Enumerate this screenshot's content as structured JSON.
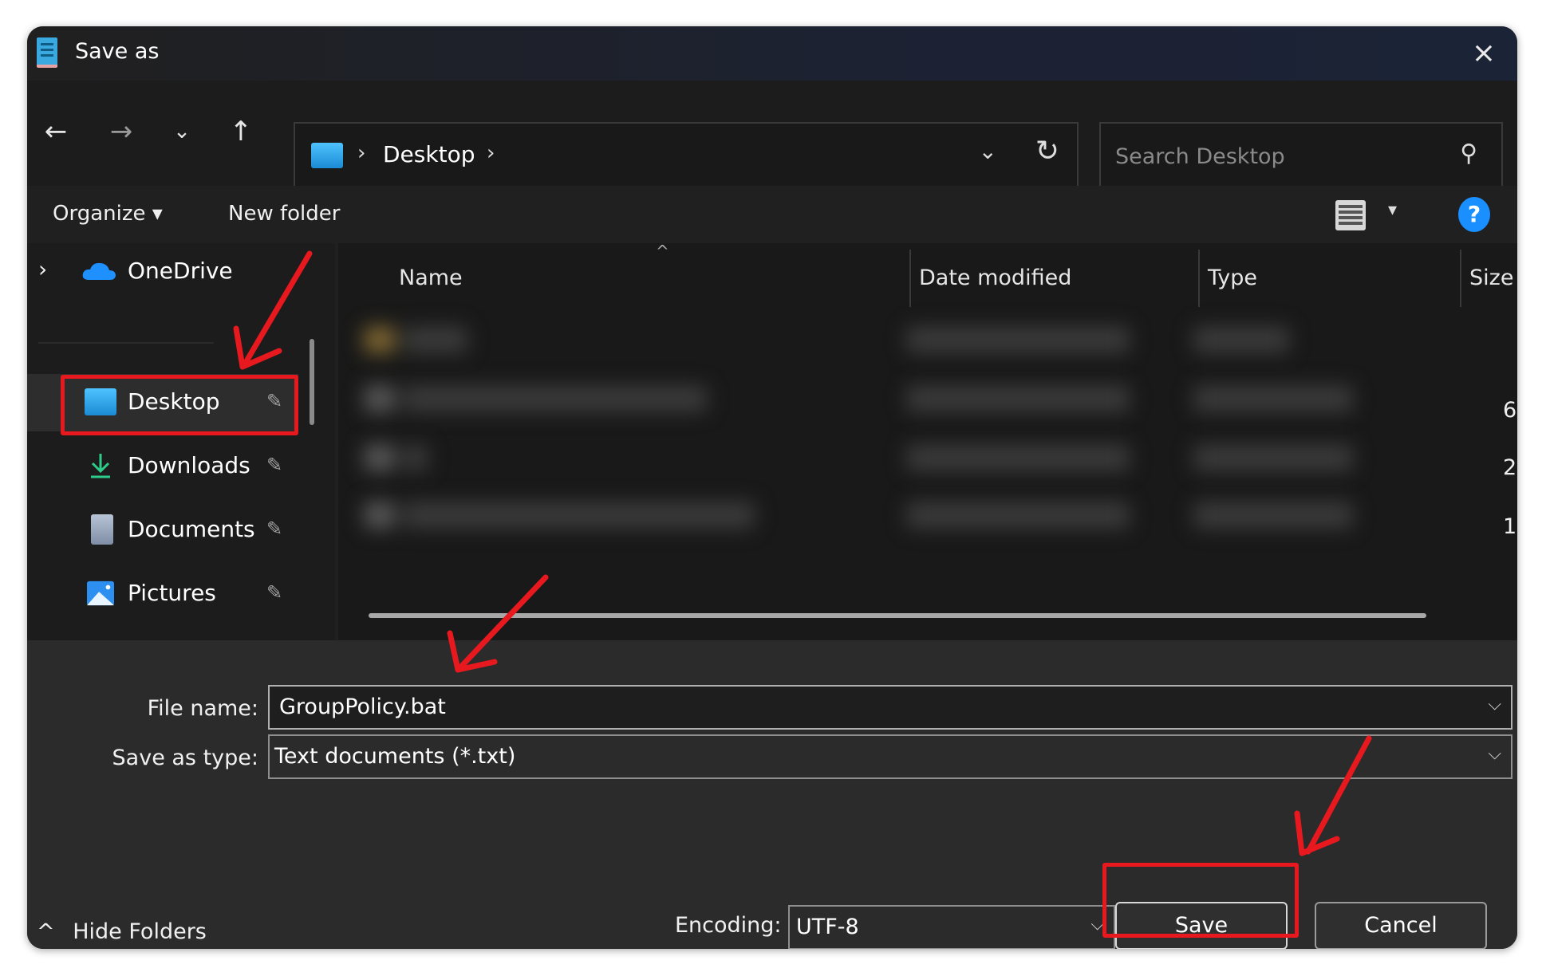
{
  "window": {
    "title": "Save as",
    "close_label": "×"
  },
  "nav": {
    "back_icon": "←",
    "forward_icon": "→",
    "recent_icon": "⌄",
    "up_icon": "↑",
    "address": {
      "separator": "›",
      "crumb": "Desktop",
      "trailing_separator": "›",
      "dropdown_icon": "⌄",
      "refresh_icon": "↻"
    },
    "search": {
      "placeholder": "Search Desktop",
      "value": "",
      "icon": "⚲"
    }
  },
  "commandbar": {
    "organize_label": "Organize ▾",
    "new_folder_label": "New folder",
    "view_dropdown_icon": "▾",
    "help_label": "?"
  },
  "sidebar": {
    "onedrive": {
      "expander": "›",
      "label": "OneDrive"
    },
    "items": [
      {
        "label": "Desktop",
        "pin": "📌",
        "selected": true
      },
      {
        "label": "Downloads",
        "pin": "📌"
      },
      {
        "label": "Documents",
        "pin": "📌"
      },
      {
        "label": "Pictures",
        "pin": "📌"
      }
    ]
  },
  "filelist": {
    "sort_indicator": "^",
    "columns": [
      "Name",
      "Date modified",
      "Type",
      "Size"
    ],
    "visible_size_digits": [
      "6",
      "2",
      "1"
    ]
  },
  "form": {
    "file_name_label": "File name:",
    "file_name_value": "GroupPolicy.bat",
    "save_type_label": "Save as type:",
    "save_type_value": "Text documents (*.txt)",
    "dropdown_icon": "⌵",
    "encoding_label": "Encoding:",
    "encoding_value": "UTF-8",
    "save_label": "Save",
    "cancel_label": "Cancel",
    "hide_folders_icon": "^",
    "hide_folders_label": "Hide Folders"
  },
  "annotations": {
    "highlight_color": "#e8191e"
  }
}
